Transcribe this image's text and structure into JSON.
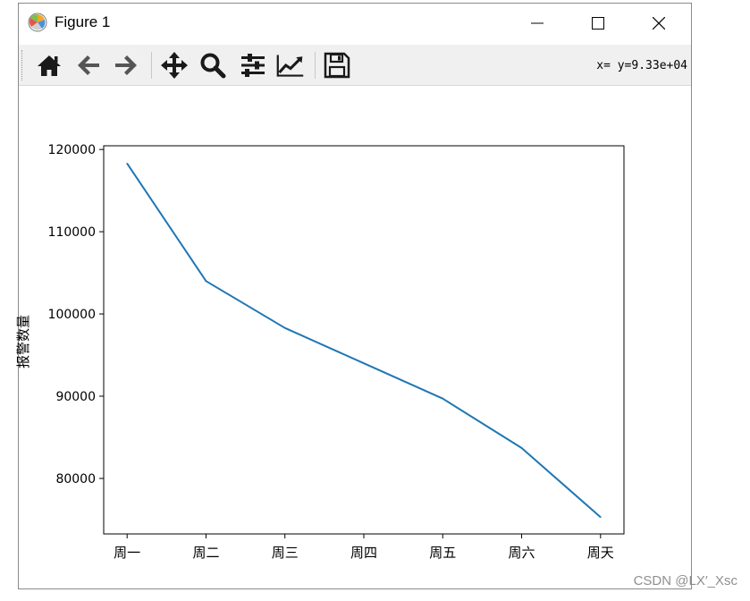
{
  "window": {
    "title": "Figure 1"
  },
  "toolbar": {
    "buttons": [
      {
        "name": "home-button",
        "icon": "home-icon"
      },
      {
        "name": "back-button",
        "icon": "arrow-left-icon"
      },
      {
        "name": "forward-button",
        "icon": "arrow-right-icon"
      },
      {
        "name": "pan-button",
        "icon": "move-icon"
      },
      {
        "name": "zoom-button",
        "icon": "magnifier-icon"
      },
      {
        "name": "subplots-button",
        "icon": "sliders-icon"
      },
      {
        "name": "edit-axes-button",
        "icon": "line-chart-icon"
      },
      {
        "name": "save-button",
        "icon": "floppy-disk-icon"
      }
    ],
    "coords": "x= y=9.33e+04"
  },
  "chart_data": {
    "type": "line",
    "categories": [
      "周一",
      "周二",
      "周三",
      "周四",
      "周五",
      "周六",
      "周天"
    ],
    "series": [
      {
        "values": [
          118300,
          104000,
          98300,
          94000,
          89700,
          83700,
          75300
        ],
        "color": "#1f77b4"
      }
    ],
    "ylabel": "报警数量",
    "xlabel": "",
    "yticks": [
      80000,
      90000,
      100000,
      110000,
      120000
    ],
    "yticklabels": [
      "80000",
      "90000",
      "100000",
      "110000",
      "120000"
    ],
    "ylim": [
      73250,
      120450
    ],
    "grid": false
  },
  "watermark": "CSDN @LX′_Xsc"
}
